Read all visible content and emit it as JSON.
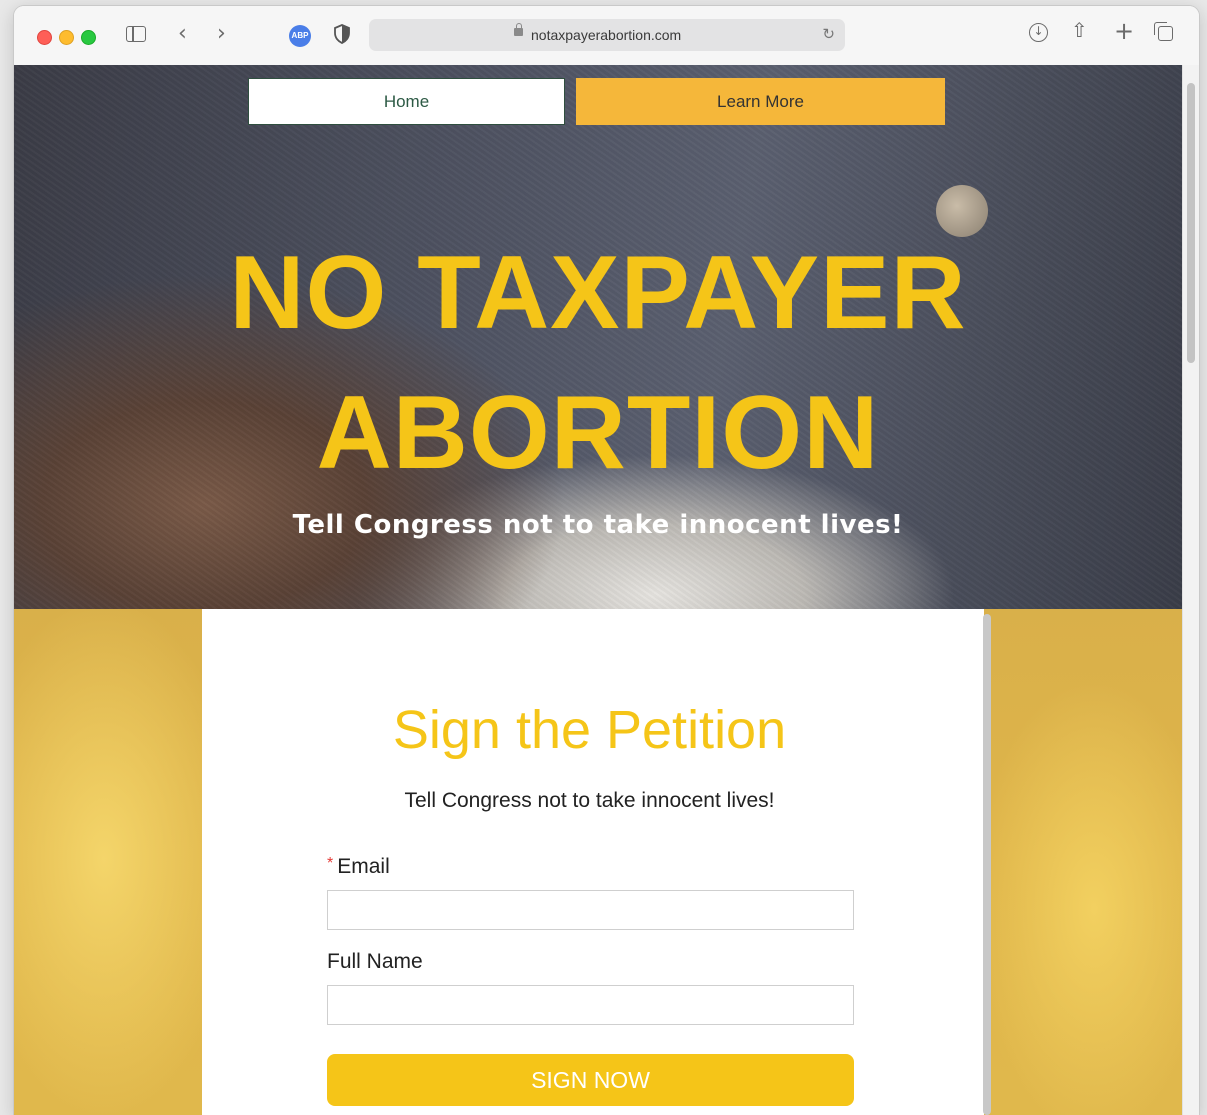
{
  "browser": {
    "url": "notaxpayerabortion.com",
    "extension_badge": "ABP"
  },
  "nav": {
    "home_label": "Home",
    "learn_more_label": "Learn More"
  },
  "hero": {
    "title_line1": "NO TAXPAYER",
    "title_line2": "ABORTION",
    "subtitle": "Tell Congress not to take innocent lives!"
  },
  "petition": {
    "title": "Sign the Petition",
    "subtitle": "Tell Congress not to take innocent lives!",
    "required_marker": "*",
    "email_label": "Email",
    "email_value": "",
    "full_name_label": "Full Name",
    "full_name_value": "",
    "submit_label": "SIGN NOW"
  },
  "colors": {
    "accent_yellow": "#f5c518",
    "nav_orange": "#f5b73a",
    "nav_home_text": "#2d5a45"
  }
}
